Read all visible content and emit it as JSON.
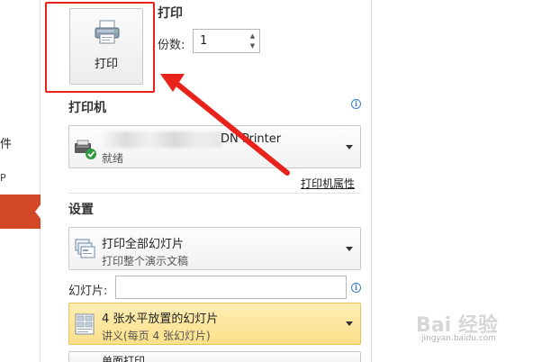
{
  "sidebar": {
    "partial_label_1": "件",
    "partial_label_2": "P"
  },
  "print": {
    "section_title": "打印",
    "button_label": "打印",
    "copies_label": "份数:",
    "copies_value": "1"
  },
  "printer": {
    "section_title": "打印机",
    "name_visible": "DN Printer",
    "status": "就绪",
    "properties_link": "打印机属性"
  },
  "settings": {
    "section_title": "设置",
    "scope_main": "打印全部幻灯片",
    "scope_sub": "打印整个演示文稿",
    "slides_label": "幻灯片:",
    "slides_value": "",
    "layout_main": "4 张水平放置的幻灯片",
    "layout_sub": "讲义(每页 4 张幻灯片)",
    "next_partial": "单面打印"
  },
  "colors": {
    "annotation_red": "#e8231c",
    "sidebar_accent": "#d24726",
    "highlight_yellow": "#fbe08a"
  },
  "watermark": {
    "main": "Bai 经验",
    "sub": "jingyan.baidu.com"
  }
}
